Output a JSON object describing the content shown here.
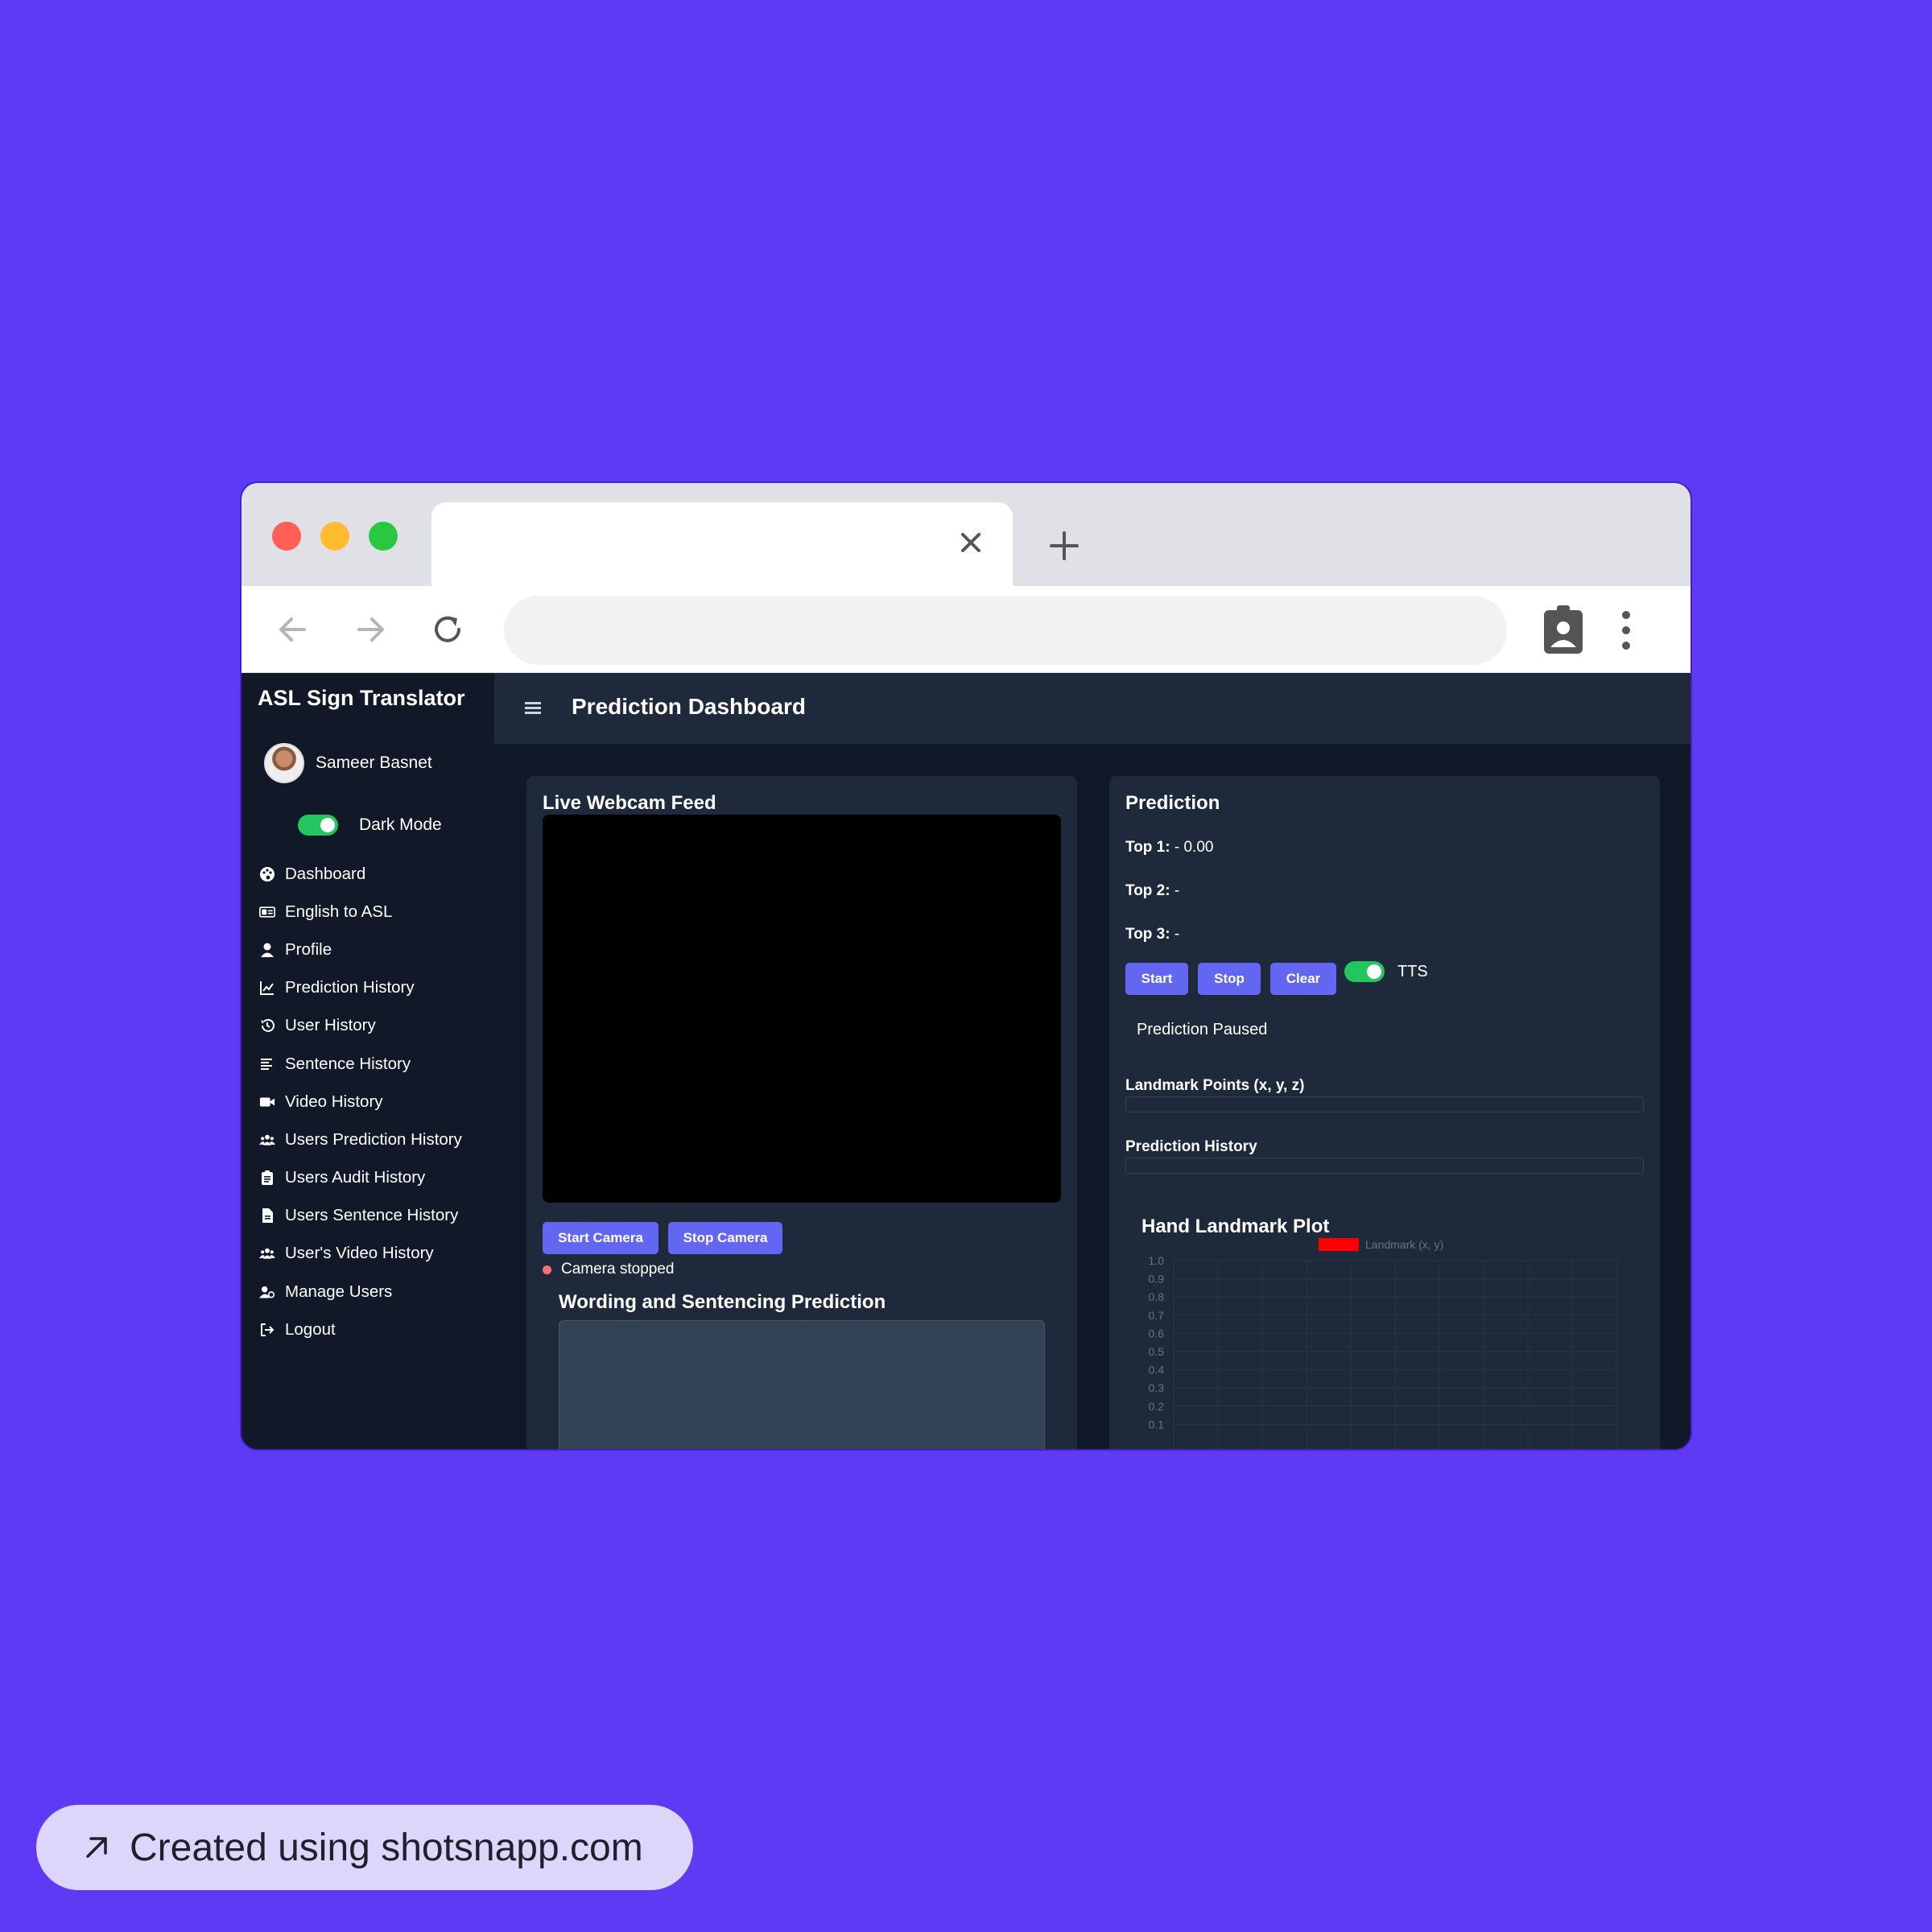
{
  "app": {
    "brand": "ASL Sign Translator",
    "user_name": "Sameer Basnet",
    "dark_mode_label": "Dark Mode",
    "page_title": "Prediction Dashboard"
  },
  "sidebar": {
    "items": [
      {
        "label": "Dashboard",
        "icon": "palette-icon"
      },
      {
        "label": "English to ASL",
        "icon": "id-card-icon"
      },
      {
        "label": "Profile",
        "icon": "user-icon"
      },
      {
        "label": "Prediction History",
        "icon": "line-chart-icon"
      },
      {
        "label": "User History",
        "icon": "history-icon"
      },
      {
        "label": "Sentence History",
        "icon": "align-left-icon"
      },
      {
        "label": "Video History",
        "icon": "video-icon"
      },
      {
        "label": "Users Prediction History",
        "icon": "users-icon"
      },
      {
        "label": "Users Audit History",
        "icon": "clipboard-icon"
      },
      {
        "label": "Users Sentence History",
        "icon": "file-icon"
      },
      {
        "label": "User's Video History",
        "icon": "users-icon"
      },
      {
        "label": "Manage Users",
        "icon": "user-gear-icon"
      },
      {
        "label": "Logout",
        "icon": "logout-icon"
      }
    ]
  },
  "webcam": {
    "title": "Live Webcam Feed",
    "start_label": "Start Camera",
    "stop_label": "Stop Camera",
    "status": "Camera stopped",
    "sentence_title": "Wording and Sentencing Prediction"
  },
  "prediction": {
    "title": "Prediction",
    "top1_label": "Top 1:",
    "top1_value": " - 0.00",
    "top2_label": "Top 2:",
    "top2_value": " -",
    "top3_label": "Top 3:",
    "top3_value": " -",
    "start_label": "Start",
    "stop_label": "Stop",
    "clear_label": "Clear",
    "tts_label": "TTS",
    "status": "Prediction Paused",
    "landmark_label": "Landmark Points (x, y, z)",
    "history_label": "Prediction History"
  },
  "chart_data": {
    "type": "scatter",
    "title": "Hand Landmark Plot",
    "series": [
      {
        "name": "Landmark (x, y)",
        "color": "#FF0000",
        "values": []
      }
    ],
    "y_ticks": [
      "1.0",
      "0.9",
      "0.8",
      "0.7",
      "0.6",
      "0.5",
      "0.4",
      "0.3",
      "0.2",
      "0.1"
    ],
    "ylim": [
      0,
      1
    ],
    "grid": true,
    "legend": "top-center"
  },
  "badge": {
    "text": "Created using shotsnapp.com"
  },
  "colors": {
    "background": "#5E3AF4",
    "accent": "#6366F1",
    "toggle_on": "#22C55E",
    "status_dot": "#F87171"
  }
}
